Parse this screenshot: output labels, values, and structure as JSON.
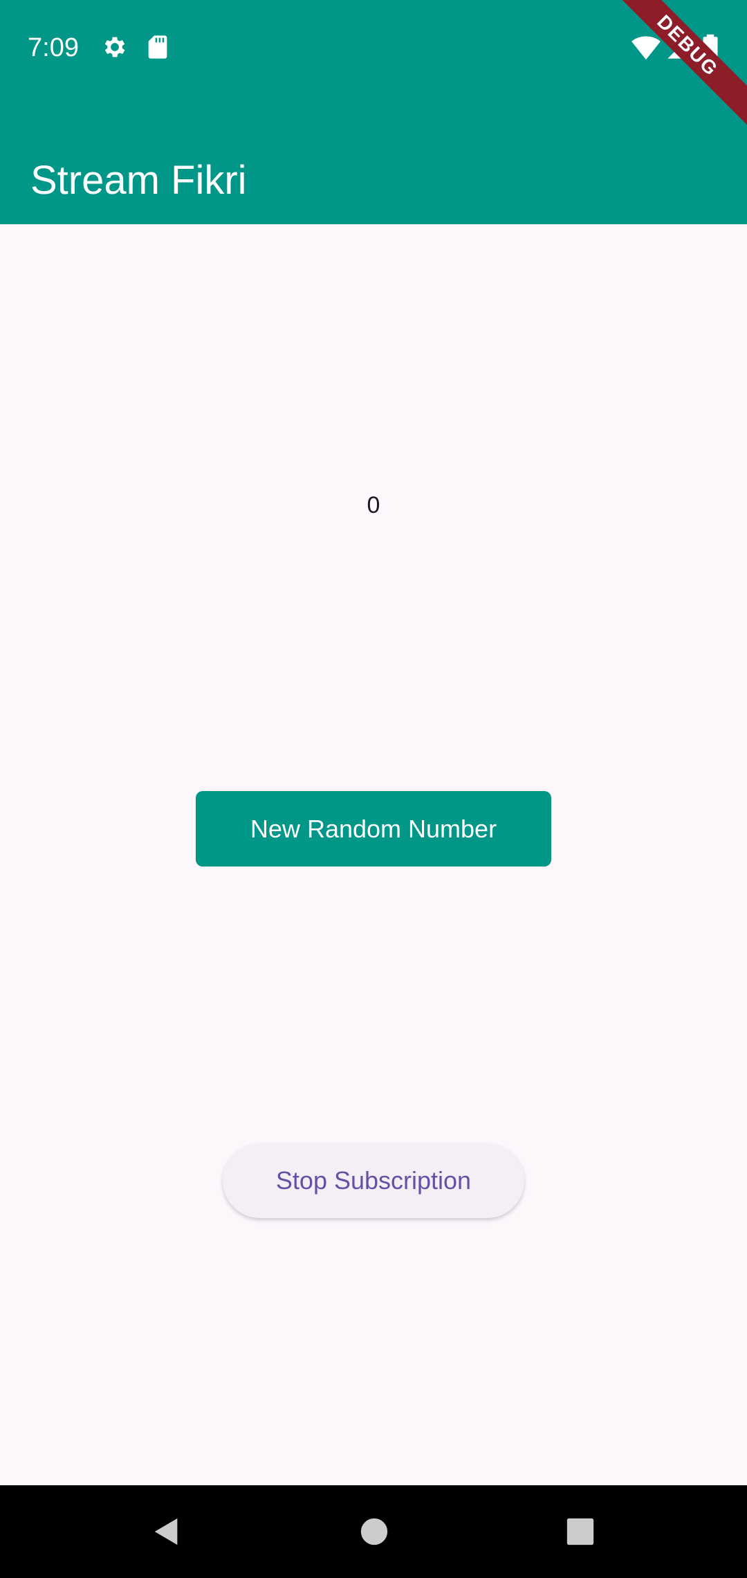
{
  "status_bar": {
    "time": "7:09",
    "icons_left": [
      "gear-icon",
      "sd-card-icon"
    ],
    "icons_right": [
      "wifi-icon",
      "cell-signal-icon",
      "battery-icon"
    ]
  },
  "app_bar": {
    "title": "Stream Fikri"
  },
  "debug_banner": {
    "label": "DEBUG"
  },
  "main": {
    "counter_value": "0",
    "new_random_button_label": "New Random Number",
    "stop_subscription_button_label": "Stop Subscription"
  },
  "navigation_bar": {
    "buttons": [
      "back-icon",
      "home-icon",
      "recents-icon"
    ]
  },
  "colors": {
    "primary": "#009688",
    "background": "#fdf7fc",
    "secondary_text": "#6750a4",
    "debug_ribbon": "#8e1d2a"
  }
}
